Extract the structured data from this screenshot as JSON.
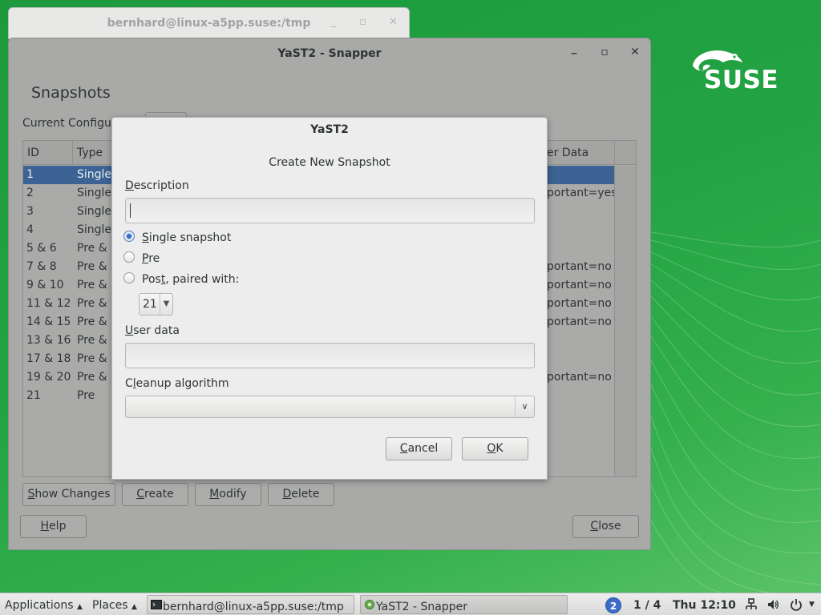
{
  "desktop": {
    "logo_text": "SUSE"
  },
  "terminal_window": {
    "title": "bernhard@linux-a5pp.suse:/tmp"
  },
  "main_window": {
    "title": "YaST2 - Snapper",
    "heading": "Snapshots",
    "current_config_label": "Current Configur",
    "columns": [
      "ID",
      "Type",
      "er Data"
    ],
    "rows": [
      {
        "id": "1",
        "type": "Single",
        "userdata": ""
      },
      {
        "id": "2",
        "type": "Single",
        "userdata": "portant=yes"
      },
      {
        "id": "3",
        "type": "Single",
        "userdata": ""
      },
      {
        "id": "4",
        "type": "Single",
        "userdata": ""
      },
      {
        "id": "5 & 6",
        "type": "Pre &",
        "userdata": ""
      },
      {
        "id": "7 & 8",
        "type": "Pre &",
        "userdata": "portant=no"
      },
      {
        "id": "9 & 10",
        "type": "Pre &",
        "userdata": "portant=no"
      },
      {
        "id": "11 & 12",
        "type": "Pre &",
        "userdata": "portant=no"
      },
      {
        "id": "14 & 15",
        "type": "Pre &",
        "userdata": "portant=no"
      },
      {
        "id": "13 & 16",
        "type": "Pre &",
        "userdata": ""
      },
      {
        "id": "17 & 18",
        "type": "Pre &",
        "userdata": ""
      },
      {
        "id": "19 & 20",
        "type": "Pre &",
        "userdata": "portant=no"
      },
      {
        "id": "21",
        "type": "Pre",
        "userdata": ""
      }
    ],
    "selected_row": 0,
    "buttons": {
      "show_changes": {
        "pre": "",
        "u": "S",
        "post": "how Changes"
      },
      "create": {
        "pre": "",
        "u": "C",
        "post": "reate"
      },
      "modify": {
        "pre": "",
        "u": "M",
        "post": "odify"
      },
      "delete": {
        "pre": "",
        "u": "D",
        "post": "elete"
      },
      "help": {
        "pre": "",
        "u": "H",
        "post": "elp"
      },
      "close": {
        "pre": "",
        "u": "C",
        "post": "lose"
      }
    }
  },
  "dialog": {
    "title": "YaST2",
    "heading": "Create New Snapshot",
    "description_label": {
      "pre": "",
      "u": "D",
      "post": "escription"
    },
    "description_value": "",
    "radio_single": {
      "pre": "",
      "u": "S",
      "post": "ingle snapshot"
    },
    "radio_pre": {
      "pre": "",
      "u": "P",
      "post": "re"
    },
    "radio_post": {
      "pre": "Pos",
      "u": "t",
      "post": ", paired with:"
    },
    "selected_radio": "single",
    "paired_with_value": "21",
    "userdata_label": {
      "pre": "",
      "u": "U",
      "post": "ser data"
    },
    "userdata_value": "",
    "cleanup_label": {
      "pre": "C",
      "u": "l",
      "post": "eanup algorithm"
    },
    "cleanup_value": "",
    "cancel": {
      "pre": "",
      "u": "C",
      "post": "ancel"
    },
    "ok": {
      "pre": "",
      "u": "O",
      "post": "K"
    }
  },
  "taskbar": {
    "applications": "Applications",
    "places": "Places",
    "task_terminal": "bernhard@linux-a5pp.suse:/tmp",
    "task_yast": "YaST2 - Snapper",
    "workspace_badge": "2",
    "workspace": "1 / 4",
    "clock": "Thu 12:10"
  },
  "colors": {
    "desktop_green": "#23a343",
    "selection_blue": "#3d6394",
    "radio_blue": "#3a75c4"
  }
}
